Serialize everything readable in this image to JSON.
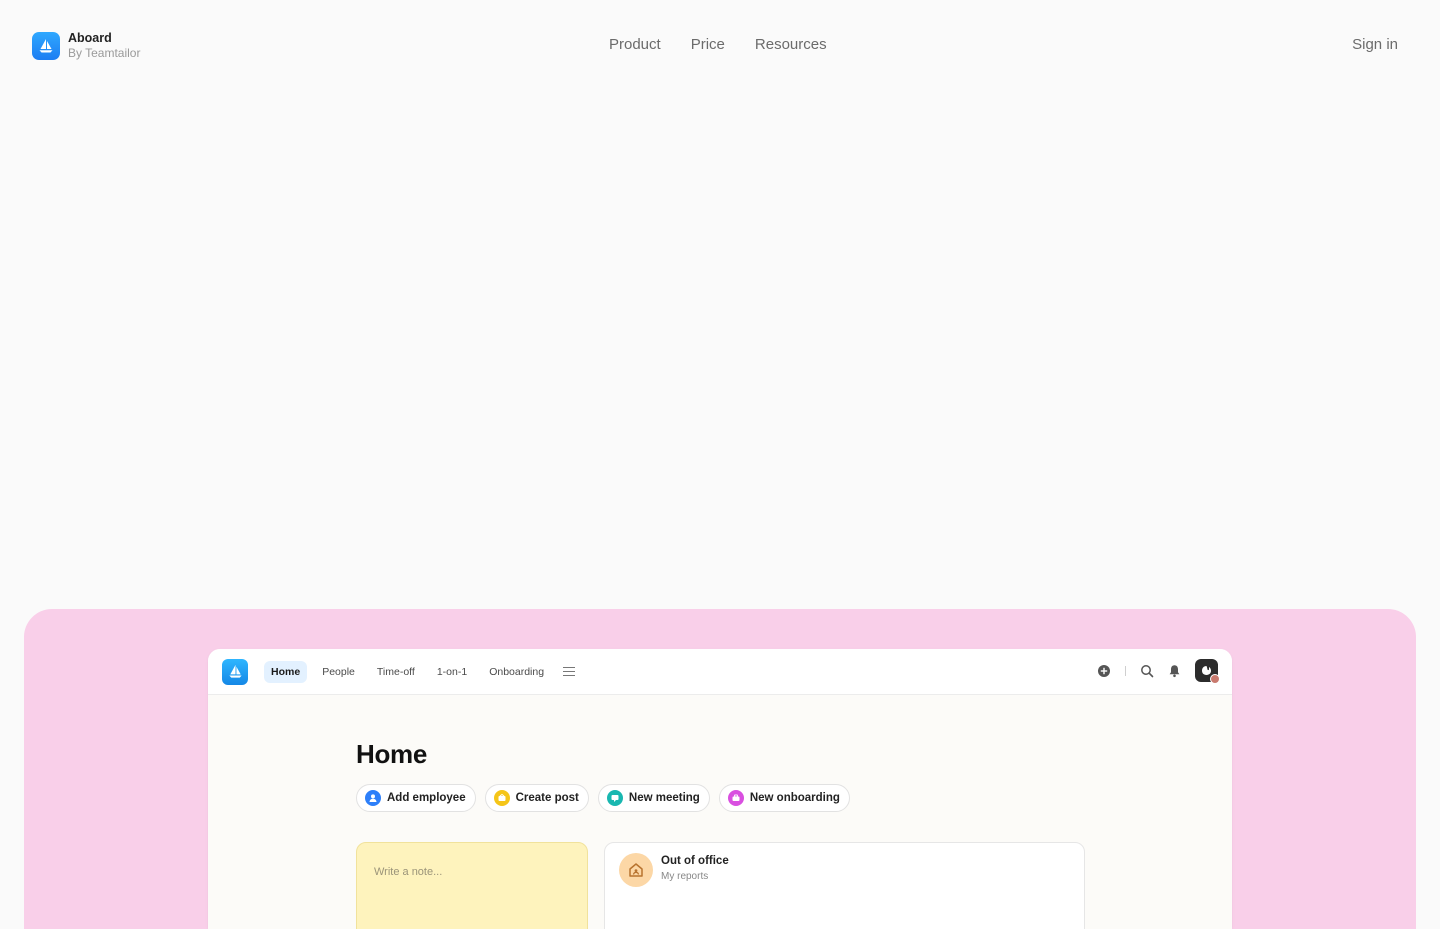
{
  "brand": {
    "name": "Aboard",
    "subtitle": "By Teamtailor"
  },
  "nav": {
    "items": [
      "Product",
      "Price",
      "Resources"
    ],
    "sign_in": "Sign in"
  },
  "app": {
    "tabs": [
      {
        "label": "Home",
        "active": true
      },
      {
        "label": "People",
        "active": false
      },
      {
        "label": "Time-off",
        "active": false
      },
      {
        "label": "1-on-1",
        "active": false
      },
      {
        "label": "Onboarding",
        "active": false
      }
    ],
    "page_title": "Home",
    "quick_actions": [
      {
        "label": "Add employee",
        "icon": "user-icon",
        "color": "#2d7ff9"
      },
      {
        "label": "Create post",
        "icon": "post-icon",
        "color": "#f5c518"
      },
      {
        "label": "New meeting",
        "icon": "meeting-icon",
        "color": "#19b7b0"
      },
      {
        "label": "New onboarding",
        "icon": "onboarding-icon",
        "color": "#d94fe0"
      }
    ],
    "note": {
      "placeholder": "Write a note..."
    },
    "out_of_office": {
      "title": "Out of office",
      "subtitle": "My reports"
    }
  },
  "colors": {
    "panel_pink": "#f9cfe9",
    "brand_blue": "#1d7df2",
    "active_tab_bg": "#e3f1ff",
    "note_yellow": "#fef3bd"
  }
}
